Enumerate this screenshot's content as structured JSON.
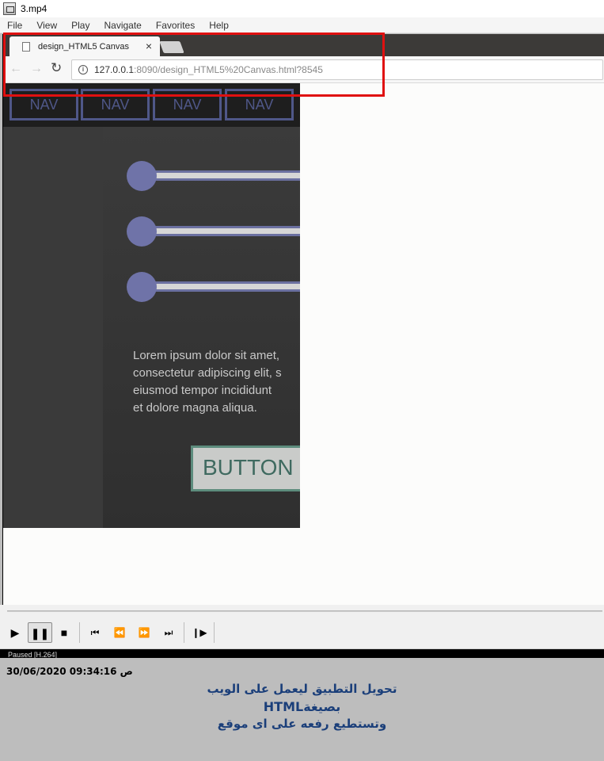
{
  "window": {
    "title": "3.mp4"
  },
  "menu": [
    "File",
    "View",
    "Play",
    "Navigate",
    "Favorites",
    "Help"
  ],
  "browser": {
    "tab_title": "design_HTML5 Canvas",
    "tab_close": "×",
    "url_host": "127.0.0.1",
    "url_rest": ":8090/design_HTML5%20Canvas.html?8545"
  },
  "app": {
    "nav_items": [
      "NAV",
      "NAV",
      "NAV",
      "NAV"
    ],
    "sliders": 3,
    "lorem": "Lorem ipsum dolor sit amet,\nconsectetur adipiscing elit, s\neiusmod tempor incididunt\net dolore magna aliqua.",
    "button_label": "BUTTON"
  },
  "player": {
    "status_text": "Paused [H.264]"
  },
  "caption": {
    "timestamp": "30/06/2020 09:34:16 ص",
    "line1": "تحويل التطبيق  ليعمل على الويب",
    "line2": "بصيغةHTML",
    "line3": "وتستطيع رفعه على اى موقع"
  },
  "colors": {
    "highlight": "#e01010",
    "nav_border": "#4f5788",
    "slider_knob": "#6f73a8",
    "button_border": "#5d8c7d",
    "caption_text": "#1b3f7a"
  }
}
